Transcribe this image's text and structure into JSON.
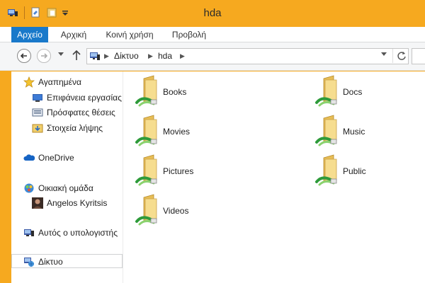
{
  "window": {
    "title": "hda"
  },
  "ribbon": {
    "tabs": [
      {
        "label": "Αρχείο"
      },
      {
        "label": "Αρχική"
      },
      {
        "label": "Κοινή χρήση"
      },
      {
        "label": "Προβολή"
      }
    ]
  },
  "address": {
    "crumbs": [
      {
        "label": "Δίκτυο"
      },
      {
        "label": "hda"
      }
    ]
  },
  "nav": {
    "favorites": {
      "label": "Αγαπημένα"
    },
    "desktop": {
      "label": "Επιφάνεια εργασίας"
    },
    "recent": {
      "label": "Πρόσφατες θέσεις"
    },
    "downloads": {
      "label": "Στοιχεία λήψης"
    },
    "onedrive": {
      "label": "OneDrive"
    },
    "homegroup": {
      "label": "Οικιακή ομάδα"
    },
    "user": {
      "label": "Angelos Kyritsis"
    },
    "computer": {
      "label": "Αυτός ο υπολογιστής"
    },
    "network": {
      "label": "Δίκτυο"
    }
  },
  "folders": [
    {
      "label": "Books"
    },
    {
      "label": "Docs"
    },
    {
      "label": "Movies"
    },
    {
      "label": "Music"
    },
    {
      "label": "Pictures"
    },
    {
      "label": "Public"
    },
    {
      "label": "Videos"
    }
  ],
  "colors": {
    "titlebar": "#f6a91f",
    "file_tab": "#1979ca",
    "folder": "#f5d77a",
    "share_pipe": "#2e9b3a"
  }
}
